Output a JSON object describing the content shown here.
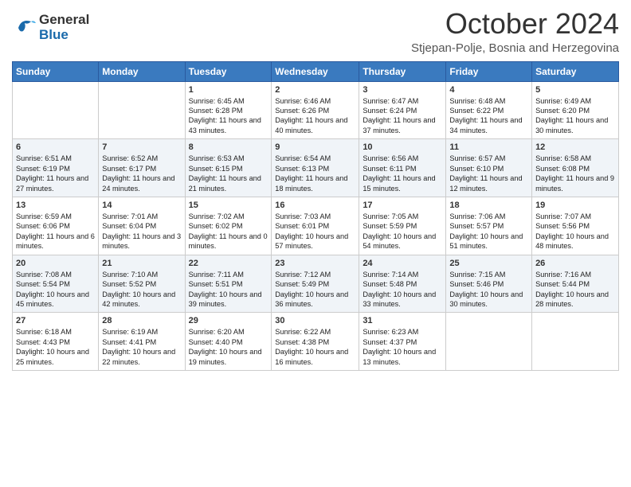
{
  "header": {
    "logo_general": "General",
    "logo_blue": "Blue",
    "month_title": "October 2024",
    "location": "Stjepan-Polje, Bosnia and Herzegovina"
  },
  "days_of_week": [
    "Sunday",
    "Monday",
    "Tuesday",
    "Wednesday",
    "Thursday",
    "Friday",
    "Saturday"
  ],
  "weeks": [
    [
      {
        "day": "",
        "sunrise": "",
        "sunset": "",
        "daylight": ""
      },
      {
        "day": "",
        "sunrise": "",
        "sunset": "",
        "daylight": ""
      },
      {
        "day": "1",
        "sunrise": "Sunrise: 6:45 AM",
        "sunset": "Sunset: 6:28 PM",
        "daylight": "Daylight: 11 hours and 43 minutes."
      },
      {
        "day": "2",
        "sunrise": "Sunrise: 6:46 AM",
        "sunset": "Sunset: 6:26 PM",
        "daylight": "Daylight: 11 hours and 40 minutes."
      },
      {
        "day": "3",
        "sunrise": "Sunrise: 6:47 AM",
        "sunset": "Sunset: 6:24 PM",
        "daylight": "Daylight: 11 hours and 37 minutes."
      },
      {
        "day": "4",
        "sunrise": "Sunrise: 6:48 AM",
        "sunset": "Sunset: 6:22 PM",
        "daylight": "Daylight: 11 hours and 34 minutes."
      },
      {
        "day": "5",
        "sunrise": "Sunrise: 6:49 AM",
        "sunset": "Sunset: 6:20 PM",
        "daylight": "Daylight: 11 hours and 30 minutes."
      }
    ],
    [
      {
        "day": "6",
        "sunrise": "Sunrise: 6:51 AM",
        "sunset": "Sunset: 6:19 PM",
        "daylight": "Daylight: 11 hours and 27 minutes."
      },
      {
        "day": "7",
        "sunrise": "Sunrise: 6:52 AM",
        "sunset": "Sunset: 6:17 PM",
        "daylight": "Daylight: 11 hours and 24 minutes."
      },
      {
        "day": "8",
        "sunrise": "Sunrise: 6:53 AM",
        "sunset": "Sunset: 6:15 PM",
        "daylight": "Daylight: 11 hours and 21 minutes."
      },
      {
        "day": "9",
        "sunrise": "Sunrise: 6:54 AM",
        "sunset": "Sunset: 6:13 PM",
        "daylight": "Daylight: 11 hours and 18 minutes."
      },
      {
        "day": "10",
        "sunrise": "Sunrise: 6:56 AM",
        "sunset": "Sunset: 6:11 PM",
        "daylight": "Daylight: 11 hours and 15 minutes."
      },
      {
        "day": "11",
        "sunrise": "Sunrise: 6:57 AM",
        "sunset": "Sunset: 6:10 PM",
        "daylight": "Daylight: 11 hours and 12 minutes."
      },
      {
        "day": "12",
        "sunrise": "Sunrise: 6:58 AM",
        "sunset": "Sunset: 6:08 PM",
        "daylight": "Daylight: 11 hours and 9 minutes."
      }
    ],
    [
      {
        "day": "13",
        "sunrise": "Sunrise: 6:59 AM",
        "sunset": "Sunset: 6:06 PM",
        "daylight": "Daylight: 11 hours and 6 minutes."
      },
      {
        "day": "14",
        "sunrise": "Sunrise: 7:01 AM",
        "sunset": "Sunset: 6:04 PM",
        "daylight": "Daylight: 11 hours and 3 minutes."
      },
      {
        "day": "15",
        "sunrise": "Sunrise: 7:02 AM",
        "sunset": "Sunset: 6:02 PM",
        "daylight": "Daylight: 11 hours and 0 minutes."
      },
      {
        "day": "16",
        "sunrise": "Sunrise: 7:03 AM",
        "sunset": "Sunset: 6:01 PM",
        "daylight": "Daylight: 10 hours and 57 minutes."
      },
      {
        "day": "17",
        "sunrise": "Sunrise: 7:05 AM",
        "sunset": "Sunset: 5:59 PM",
        "daylight": "Daylight: 10 hours and 54 minutes."
      },
      {
        "day": "18",
        "sunrise": "Sunrise: 7:06 AM",
        "sunset": "Sunset: 5:57 PM",
        "daylight": "Daylight: 10 hours and 51 minutes."
      },
      {
        "day": "19",
        "sunrise": "Sunrise: 7:07 AM",
        "sunset": "Sunset: 5:56 PM",
        "daylight": "Daylight: 10 hours and 48 minutes."
      }
    ],
    [
      {
        "day": "20",
        "sunrise": "Sunrise: 7:08 AM",
        "sunset": "Sunset: 5:54 PM",
        "daylight": "Daylight: 10 hours and 45 minutes."
      },
      {
        "day": "21",
        "sunrise": "Sunrise: 7:10 AM",
        "sunset": "Sunset: 5:52 PM",
        "daylight": "Daylight: 10 hours and 42 minutes."
      },
      {
        "day": "22",
        "sunrise": "Sunrise: 7:11 AM",
        "sunset": "Sunset: 5:51 PM",
        "daylight": "Daylight: 10 hours and 39 minutes."
      },
      {
        "day": "23",
        "sunrise": "Sunrise: 7:12 AM",
        "sunset": "Sunset: 5:49 PM",
        "daylight": "Daylight: 10 hours and 36 minutes."
      },
      {
        "day": "24",
        "sunrise": "Sunrise: 7:14 AM",
        "sunset": "Sunset: 5:48 PM",
        "daylight": "Daylight: 10 hours and 33 minutes."
      },
      {
        "day": "25",
        "sunrise": "Sunrise: 7:15 AM",
        "sunset": "Sunset: 5:46 PM",
        "daylight": "Daylight: 10 hours and 30 minutes."
      },
      {
        "day": "26",
        "sunrise": "Sunrise: 7:16 AM",
        "sunset": "Sunset: 5:44 PM",
        "daylight": "Daylight: 10 hours and 28 minutes."
      }
    ],
    [
      {
        "day": "27",
        "sunrise": "Sunrise: 6:18 AM",
        "sunset": "Sunset: 4:43 PM",
        "daylight": "Daylight: 10 hours and 25 minutes."
      },
      {
        "day": "28",
        "sunrise": "Sunrise: 6:19 AM",
        "sunset": "Sunset: 4:41 PM",
        "daylight": "Daylight: 10 hours and 22 minutes."
      },
      {
        "day": "29",
        "sunrise": "Sunrise: 6:20 AM",
        "sunset": "Sunset: 4:40 PM",
        "daylight": "Daylight: 10 hours and 19 minutes."
      },
      {
        "day": "30",
        "sunrise": "Sunrise: 6:22 AM",
        "sunset": "Sunset: 4:38 PM",
        "daylight": "Daylight: 10 hours and 16 minutes."
      },
      {
        "day": "31",
        "sunrise": "Sunrise: 6:23 AM",
        "sunset": "Sunset: 4:37 PM",
        "daylight": "Daylight: 10 hours and 13 minutes."
      },
      {
        "day": "",
        "sunrise": "",
        "sunset": "",
        "daylight": ""
      },
      {
        "day": "",
        "sunrise": "",
        "sunset": "",
        "daylight": ""
      }
    ]
  ]
}
